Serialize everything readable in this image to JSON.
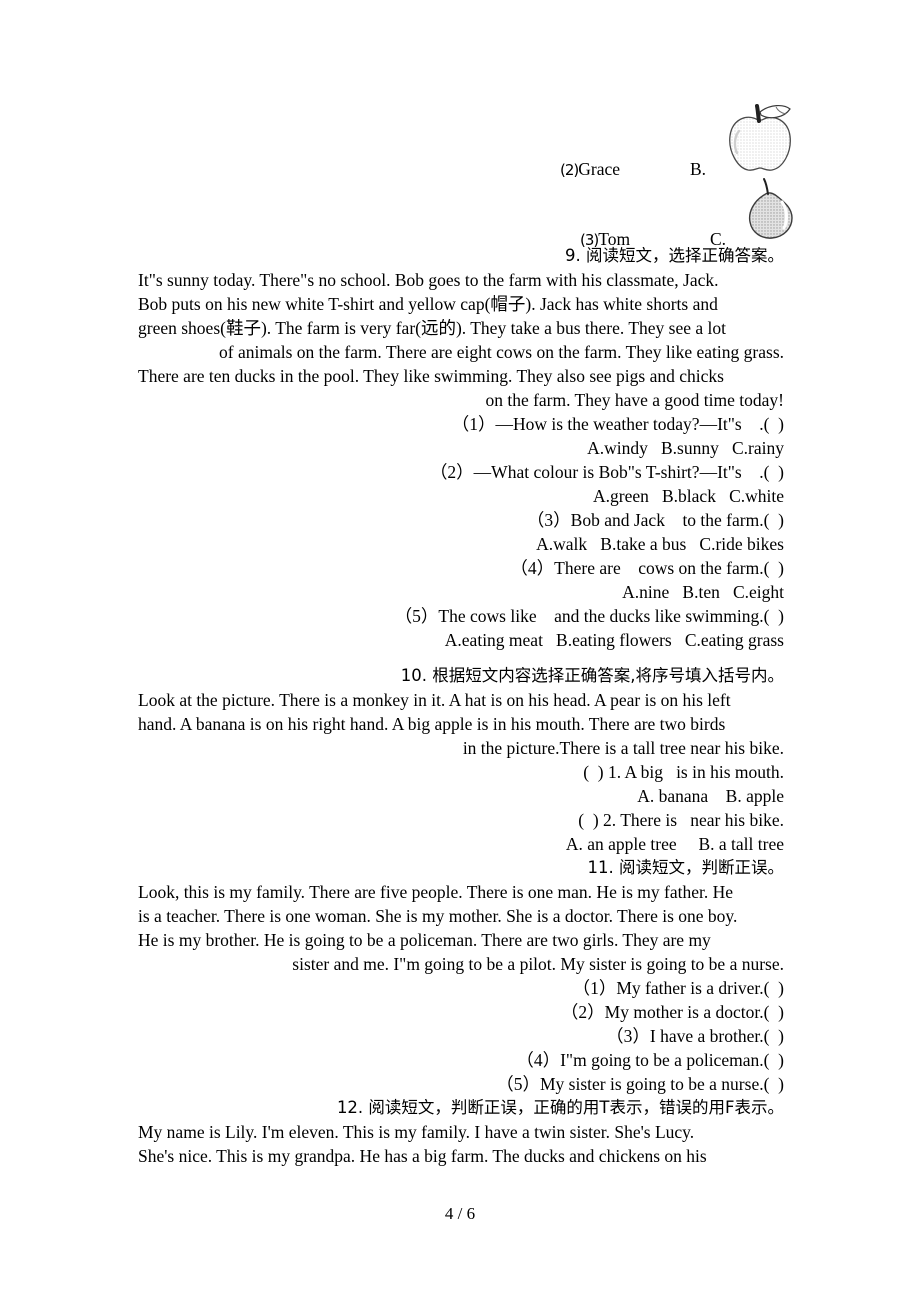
{
  "document": {
    "page_footer": "4 / 6"
  },
  "matching": {
    "items": [
      {
        "number": "(2)",
        "name": "Grace",
        "letter": "B.",
        "picture": "apple-illustration"
      },
      {
        "number": "(3)",
        "name": "Tom",
        "letter": "C.",
        "picture": "pear-illustration"
      }
    ]
  },
  "exercises": [
    {
      "id": "q9",
      "heading": "9. 阅读短文，选择正确答案。",
      "passage": [
        "It\"s sunny today. There\"s no school. Bob goes to the farm with his classmate, Jack.",
        "Bob puts on his new white T-shirt and yellow cap(帽子). Jack has white shorts and",
        "green shoes(鞋子). The farm is very far(远的). They take a bus there. They see a lot",
        "of animals on the farm. There are eight cows on the farm. They like eating grass.",
        "There are ten ducks in the pool. They like swimming. They also see pigs and chicks",
        "on the farm. They have a good time today!"
      ],
      "questions": [
        {
          "stem": "（1）—How is the weather today?—It\"s    .(  )",
          "options": "A.windy   B.sunny   C.rainy"
        },
        {
          "stem": "（2）—What colour is Bob\"s T-shirt?—It\"s    .(  )",
          "options": "A.green   B.black   C.white"
        },
        {
          "stem": "（3）Bob and Jack    to the farm.(  )",
          "options": "A.walk   B.take a bus   C.ride bikes"
        },
        {
          "stem": "（4）There are    cows on the farm.(  )",
          "options": "A.nine   B.ten   C.eight"
        },
        {
          "stem": "（5）The cows like    and the ducks like swimming.(  )",
          "options": "A.eating meat   B.eating flowers   C.eating grass"
        }
      ]
    },
    {
      "id": "q10",
      "heading": "10. 根据短文内容选择正确答案,将序号填入括号内。",
      "passage": [
        "Look at the picture. There is a monkey in it. A hat is on his head. A pear is on his left",
        "hand. A banana is on his right hand. A big apple is in his mouth. There are two birds",
        "in the picture.There is a tall tree near his bike."
      ],
      "questions": [
        {
          "stem": "(  ) 1. A big   is in his mouth.",
          "options": "A. banana    B. apple"
        },
        {
          "stem": "(  ) 2. There is   near his bike.",
          "options": "A. an apple tree     B. a tall tree"
        }
      ]
    },
    {
      "id": "q11",
      "heading": "11. 阅读短文，判断正误。",
      "passage": [
        "Look, this is my family. There are five people. There is one man. He is my father. He",
        "is a teacher. There is one woman. She is my mother. She is a doctor. There is one boy.",
        "He is my brother. He is going to be a policeman. There are two girls. They are my",
        "sister and me. I\"m going to be a pilot. My sister is going to be a nurse."
      ],
      "questions": [
        {
          "stem": "（1）My father is a driver.(  )"
        },
        {
          "stem": "（2）My mother is a doctor.(  )"
        },
        {
          "stem": "（3）I have a brother.(  )"
        },
        {
          "stem": "（4）I\"m going to be a policeman.(  )"
        },
        {
          "stem": "（5）My sister is going to be a nurse.(  )"
        }
      ]
    },
    {
      "id": "q12",
      "heading": "12. 阅读短文，判断正误，正确的用T表示，错误的用F表示。",
      "passage": [
        "My name is Lily. I'm eleven. This is my family. I have a twin sister. She's Lucy.",
        "She's nice. This is my grandpa. He has a big farm. The ducks and chickens on his"
      ],
      "questions": []
    }
  ]
}
